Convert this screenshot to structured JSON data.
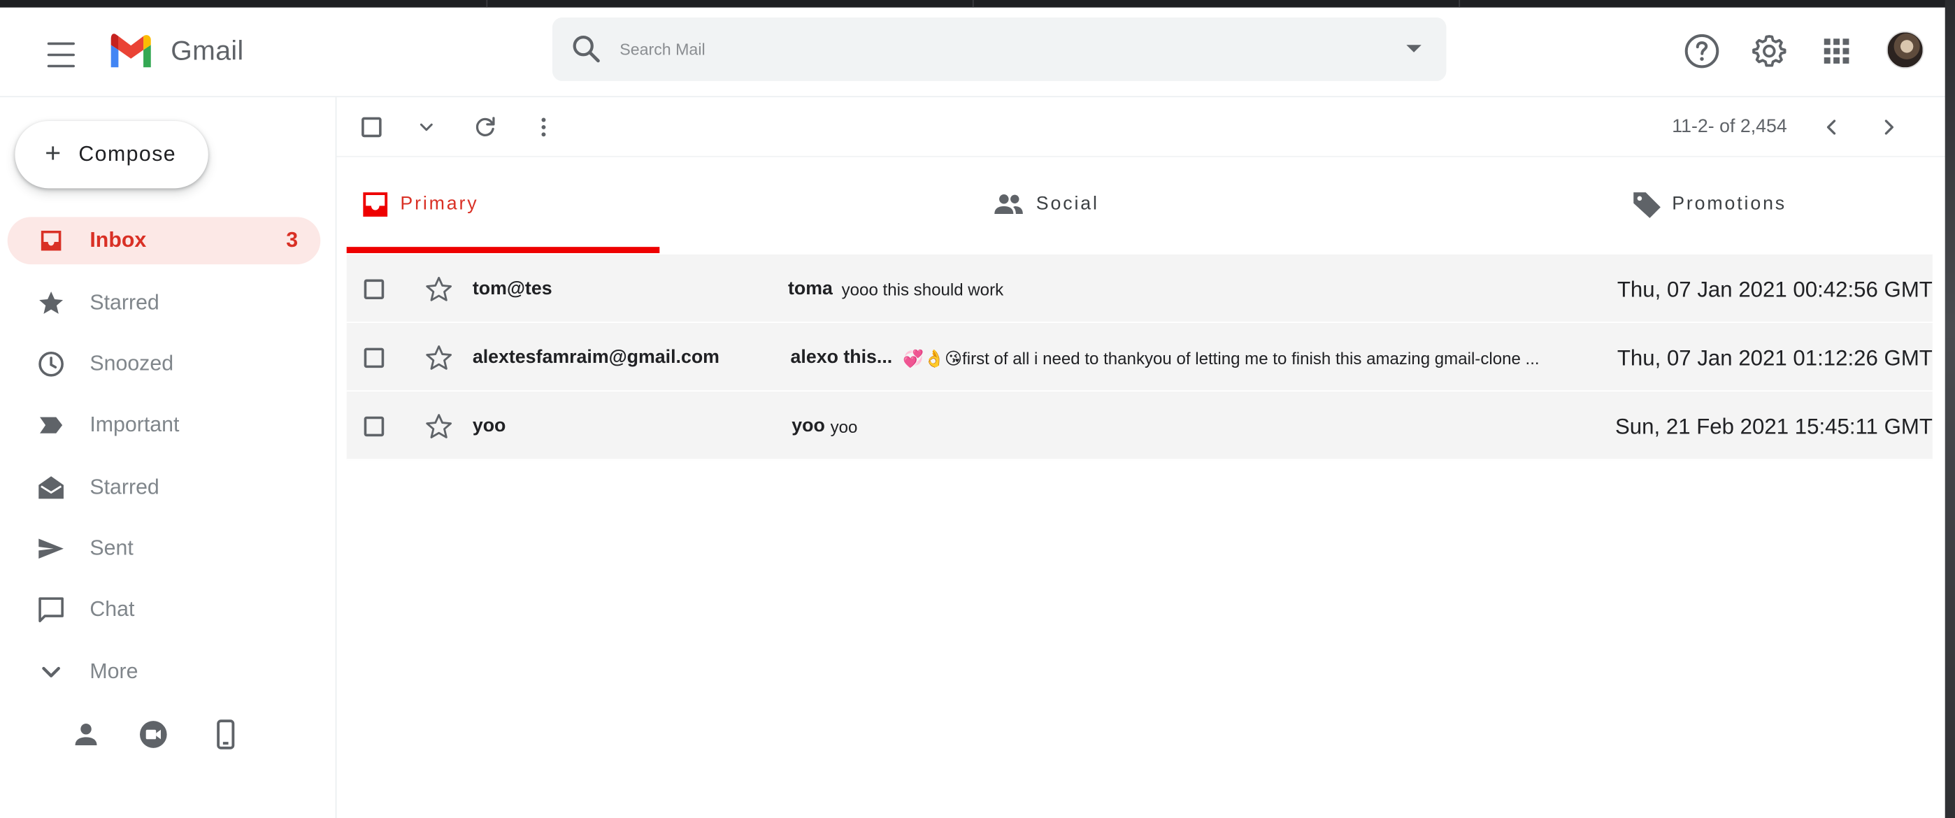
{
  "app": {
    "name": "Gmail",
    "brand_colors": {
      "red": "#ea4335",
      "blue": "#4285f4",
      "green": "#34a853",
      "yellow": "#fbbc04"
    }
  },
  "search": {
    "placeholder": "Search Mail"
  },
  "compose": {
    "label": "Compose"
  },
  "sidebar": {
    "items": [
      {
        "label": "Inbox",
        "icon": "inbox-icon",
        "count": "3",
        "active": true
      },
      {
        "label": "Starred",
        "icon": "star-icon"
      },
      {
        "label": "Snoozed",
        "icon": "clock-icon"
      },
      {
        "label": "Important",
        "icon": "label-important-icon"
      },
      {
        "label": "Starred",
        "icon": "drafts-envelope-icon"
      },
      {
        "label": "Sent",
        "icon": "send-icon"
      },
      {
        "label": "Chat",
        "icon": "chat-icon"
      },
      {
        "label": "More",
        "icon": "chevron-down-icon"
      }
    ]
  },
  "toolbar": {
    "paging": "11-2- of 2,454"
  },
  "tabs": [
    {
      "label": "Primary",
      "icon": "inbox-icon",
      "active": true
    },
    {
      "label": "Social",
      "icon": "people-icon"
    },
    {
      "label": "Promotions",
      "icon": "tag-icon"
    }
  ],
  "emails": [
    {
      "sender": "tom@tes",
      "subject": "toma",
      "snippet": "yooo this should work",
      "date": "Thu, 07 Jan 2021 00:42:56 GMT"
    },
    {
      "sender": "alextesfamraim@gmail.com",
      "subject": "alexo this...",
      "snippet": "💞👌😘first of all i need to thankyou of letting me to finish this amazing gmail-clone ...",
      "date": "Thu, 07 Jan 2021 01:12:26 GMT"
    },
    {
      "sender": "yoo",
      "subject": "yoo",
      "snippet": "yoo",
      "date": "Sun, 21 Feb 2021 15:45:11 GMT"
    }
  ],
  "accent": {
    "active_red": "#d93025",
    "tab_underline": "#ee0000",
    "active_bg": "#fce8e6"
  }
}
